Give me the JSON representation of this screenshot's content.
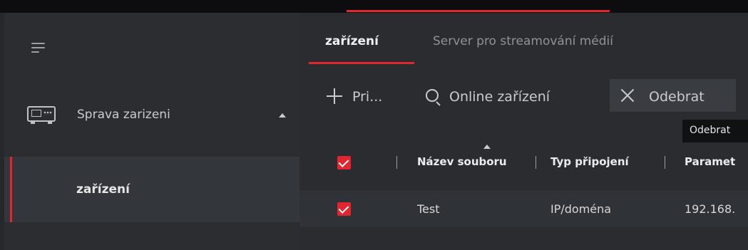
{
  "colors": {
    "accent": "#e2262f",
    "sidebar_bg": "#2b2d31",
    "main_bg": "#2a2c30"
  },
  "sidebar": {
    "menu_icon": "hamburger-icon",
    "group": {
      "icon": "device-icon",
      "label": "Sprava zarizeni",
      "expanded": true
    },
    "items": [
      {
        "label": "zařízení",
        "active": true
      }
    ]
  },
  "main": {
    "tabs": [
      {
        "label": "zařízení",
        "active": true
      },
      {
        "label": "Server pro streamování médií",
        "active": false
      }
    ],
    "toolbar": {
      "add_label": "Pri...",
      "online_label": "Online zařízení",
      "remove_label": "Odebrat"
    },
    "tooltip": "Odebrat",
    "table": {
      "headers": [
        "Název souboru",
        "Typ připojení",
        "Paramet"
      ],
      "rows": [
        {
          "checked": true,
          "name": "Test",
          "type": "IP/doména",
          "params": "192.168."
        }
      ]
    }
  }
}
